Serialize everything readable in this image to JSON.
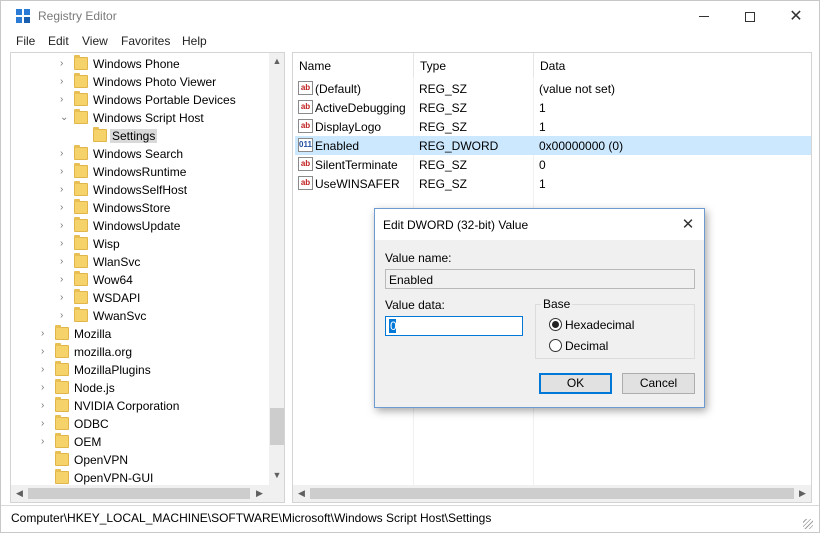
{
  "window": {
    "title": "Registry Editor",
    "minimize_glyph": "",
    "close_glyph": "✕"
  },
  "menu": [
    "File",
    "Edit",
    "View",
    "Favorites",
    "Help"
  ],
  "tree": {
    "items": [
      {
        "label": "Windows Phone",
        "level": 2,
        "expander": "›"
      },
      {
        "label": "Windows Photo Viewer",
        "level": 2,
        "expander": "›"
      },
      {
        "label": "Windows Portable Devices",
        "level": 2,
        "expander": "›"
      },
      {
        "label": "Windows Script Host",
        "level": 2,
        "expander": "⌄"
      },
      {
        "label": "Settings",
        "level": 3,
        "expander": "",
        "selected": true
      },
      {
        "label": "Windows Search",
        "level": 2,
        "expander": "›"
      },
      {
        "label": "WindowsRuntime",
        "level": 2,
        "expander": "›"
      },
      {
        "label": "WindowsSelfHost",
        "level": 2,
        "expander": "›"
      },
      {
        "label": "WindowsStore",
        "level": 2,
        "expander": "›"
      },
      {
        "label": "WindowsUpdate",
        "level": 2,
        "expander": "›"
      },
      {
        "label": "Wisp",
        "level": 2,
        "expander": "›"
      },
      {
        "label": "WlanSvc",
        "level": 2,
        "expander": "›"
      },
      {
        "label": "Wow64",
        "level": 2,
        "expander": "›"
      },
      {
        "label": "WSDAPI",
        "level": 2,
        "expander": "›"
      },
      {
        "label": "WwanSvc",
        "level": 2,
        "expander": "›"
      },
      {
        "label": "Mozilla",
        "level": 1,
        "expander": "›"
      },
      {
        "label": "mozilla.org",
        "level": 1,
        "expander": "›"
      },
      {
        "label": "MozillaPlugins",
        "level": 1,
        "expander": "›"
      },
      {
        "label": "Node.js",
        "level": 1,
        "expander": "›"
      },
      {
        "label": "NVIDIA Corporation",
        "level": 1,
        "expander": "›"
      },
      {
        "label": "ODBC",
        "level": 1,
        "expander": "›"
      },
      {
        "label": "OEM",
        "level": 1,
        "expander": "›"
      },
      {
        "label": "OpenVPN",
        "level": 1,
        "expander": ""
      },
      {
        "label": "OpenVPN-GUI",
        "level": 1,
        "expander": ""
      }
    ],
    "scroll_up": "▲",
    "scroll_down": "▼",
    "scroll_left": "◀",
    "scroll_right": "▶"
  },
  "list": {
    "columns": [
      "Name",
      "Type",
      "Data"
    ],
    "rows": [
      {
        "name": "(Default)",
        "type": "REG_SZ",
        "data": "(value not set)",
        "icon": "ab",
        "selected": false
      },
      {
        "name": "ActiveDebugging",
        "type": "REG_SZ",
        "data": "1",
        "icon": "ab",
        "selected": false
      },
      {
        "name": "DisplayLogo",
        "type": "REG_SZ",
        "data": "1",
        "icon": "ab",
        "selected": false
      },
      {
        "name": "Enabled",
        "type": "REG_DWORD",
        "data": "0x00000000 (0)",
        "icon": "011",
        "selected": true
      },
      {
        "name": "SilentTerminate",
        "type": "REG_SZ",
        "data": "0",
        "icon": "ab",
        "selected": false
      },
      {
        "name": "UseWINSAFER",
        "type": "REG_SZ",
        "data": "1",
        "icon": "ab",
        "selected": false
      }
    ]
  },
  "status": {
    "path": "Computer\\HKEY_LOCAL_MACHINE\\SOFTWARE\\Microsoft\\Windows Script Host\\Settings"
  },
  "dialog": {
    "title": "Edit DWORD (32-bit) Value",
    "close_glyph": "✕",
    "value_name_label": "Value name:",
    "value_name": "Enabled",
    "value_data_label": "Value data:",
    "value_data": "0",
    "base_label": "Base",
    "hex_label": "Hexadecimal",
    "decimal_label": "Decimal",
    "base_selected": "Hexadecimal",
    "ok_label": "OK",
    "cancel_label": "Cancel"
  },
  "colors": {
    "selection": "#cce8ff",
    "accent": "#0078d7",
    "folder": "#f6d26b"
  }
}
